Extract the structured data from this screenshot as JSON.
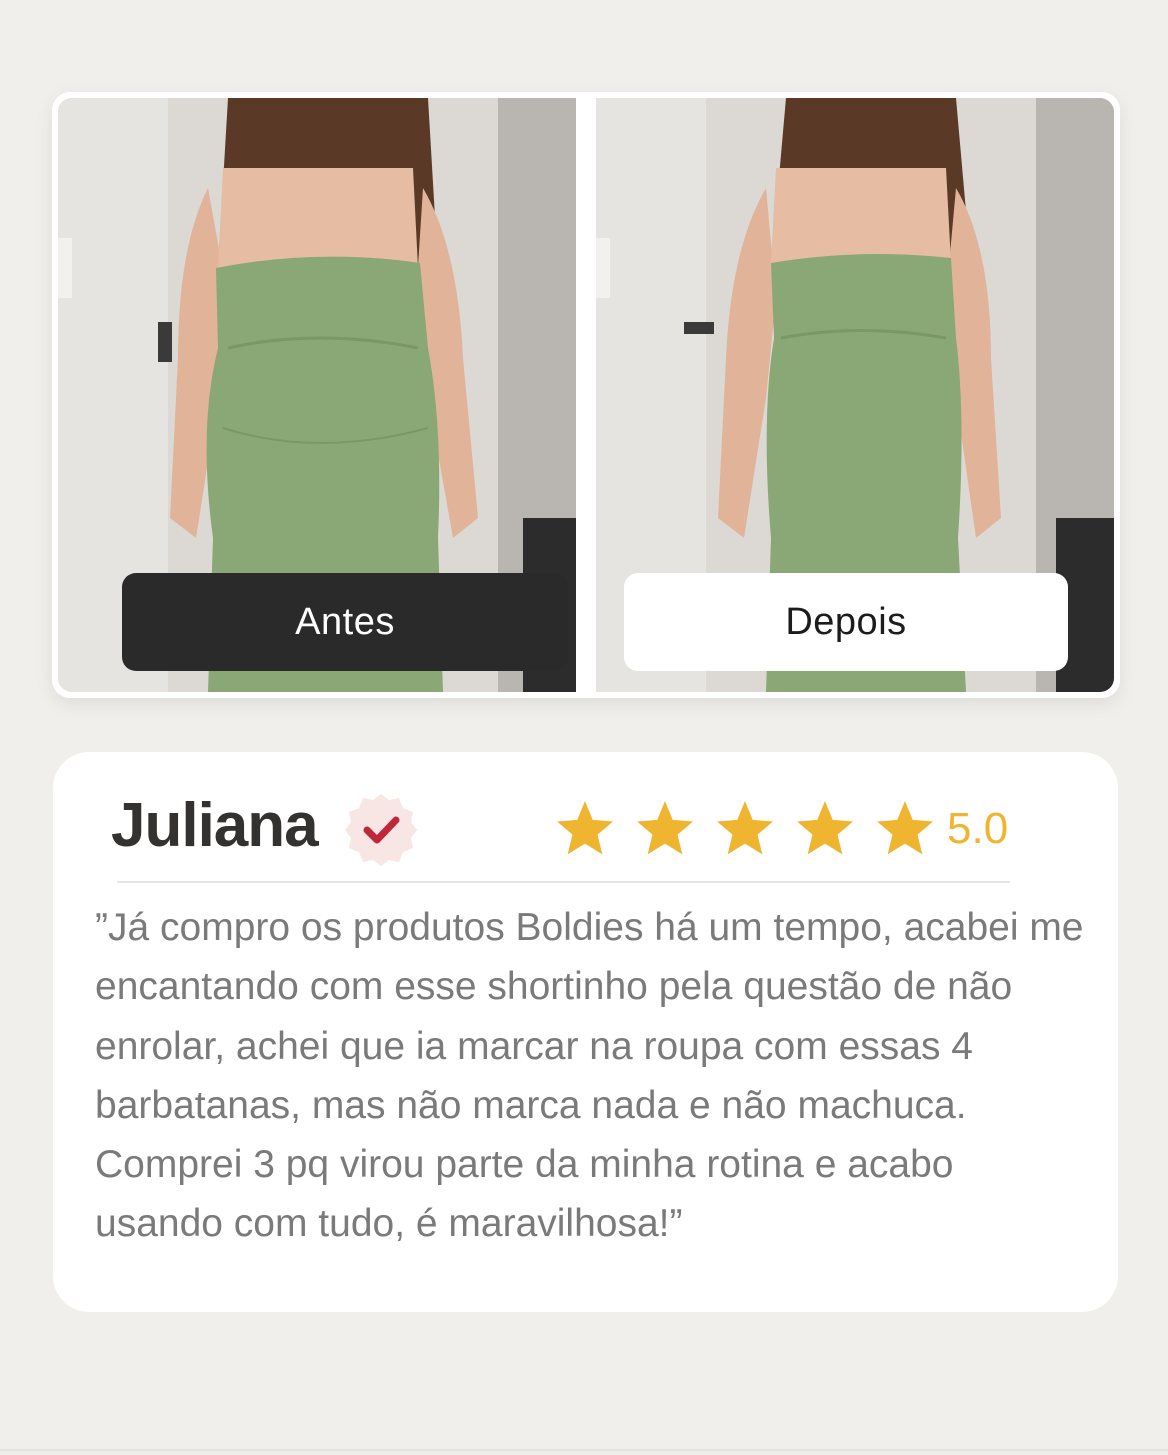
{
  "comparison": {
    "before_label": "Antes",
    "after_label": "Depois"
  },
  "review": {
    "name": "Juliana",
    "verified_icon": "verified-check-icon",
    "stars": 5,
    "rating": "5.0",
    "text": "”Já compro os produtos Boldies há um tempo, acabei me encantando com esse shortinho pela questão de não enrolar, achei que ia marcar na roupa com essas 4 barbatanas, mas não marca nada e não machuca. Comprei 3 pq virou parte da minha rotina e acabo usando com tudo, é maravilhosa!”"
  },
  "colors": {
    "background": "#f0efec",
    "star": "#f0b530",
    "verified_check": "#c0283a",
    "verified_badge": "#f7e6e4",
    "dress": "#8aa876"
  }
}
